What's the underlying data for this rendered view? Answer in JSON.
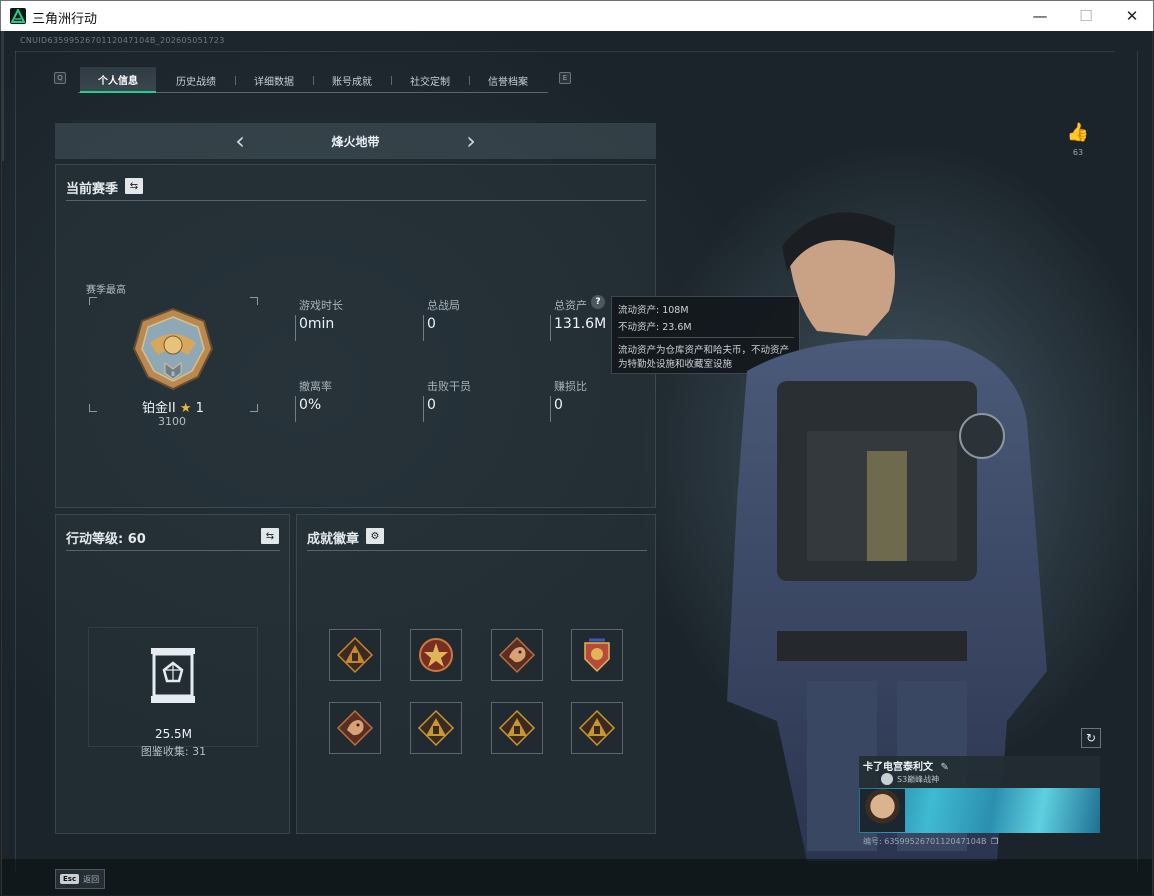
{
  "window": {
    "title": "三角洲行动"
  },
  "uid_text": "CNUID6359952670112047104B_202605051723",
  "tabs": [
    {
      "label": "个人信息",
      "active": true
    },
    {
      "label": "历史战绩",
      "active": false
    },
    {
      "label": "详细数据",
      "active": false
    },
    {
      "label": "账号成就",
      "active": false
    },
    {
      "label": "社交定制",
      "active": false
    },
    {
      "label": "信誉档案",
      "active": false
    }
  ],
  "tab_keys": {
    "left": "Q",
    "right": "E"
  },
  "mode": {
    "label": "烽火地带"
  },
  "season": {
    "title": "当前赛季",
    "rank_caption": "赛季最高",
    "rank_name": "铂金II",
    "rank_stars": "1",
    "rank_score": "3100",
    "stats": {
      "play_time": {
        "label": "游戏时长",
        "value": "0min"
      },
      "total_matches": {
        "label": "总战局",
        "value": "0"
      },
      "total_assets": {
        "label": "总资产",
        "value": "131.6M"
      },
      "evac_rate": {
        "label": "撤离率",
        "value": "0%"
      },
      "kills": {
        "label": "击败干员",
        "value": "0"
      },
      "profit_ratio": {
        "label": "赚损比",
        "value": "0"
      }
    }
  },
  "tooltip": {
    "liquid": "流动资产: 108M",
    "fixed": "不动资产: 23.6M",
    "desc1": "流动资产为仓库资产和哈夫币，不动资产",
    "desc2": "为特勤处设施和收藏室设施"
  },
  "level_panel": {
    "title": "行动等级: 60",
    "collection_value": "25.5M",
    "collection_count": "图鉴收集: 31"
  },
  "achievements": {
    "title": "成就徽章",
    "badges": [
      {
        "icon": "pyramid-badge-icon",
        "color": "#c8862a"
      },
      {
        "icon": "star-seal-badge-icon",
        "color": "#c97b3a"
      },
      {
        "icon": "dragon-badge-icon",
        "color": "#b8703a"
      },
      {
        "icon": "shield-badge-icon",
        "color": "#b84a3a"
      },
      {
        "icon": "dragon-badge-icon",
        "color": "#b8703a"
      },
      {
        "icon": "pyramid-badge-icon",
        "color": "#c8962a"
      },
      {
        "icon": "pyramid-badge-icon",
        "color": "#c8962a"
      },
      {
        "icon": "pyramid-badge-icon",
        "color": "#c8962a"
      }
    ]
  },
  "likes": {
    "count": "63"
  },
  "player_card": {
    "name": "卡了电宫泰利文",
    "rank_title": "S3巅峰战神",
    "id_text": "编号: 6359952670112047104B"
  },
  "footer": {
    "esc_key": "Esc",
    "esc_label": "返回"
  },
  "colors": {
    "accent": "#1ecf8a",
    "panel": "#28343a",
    "text": "#e6ecef"
  }
}
